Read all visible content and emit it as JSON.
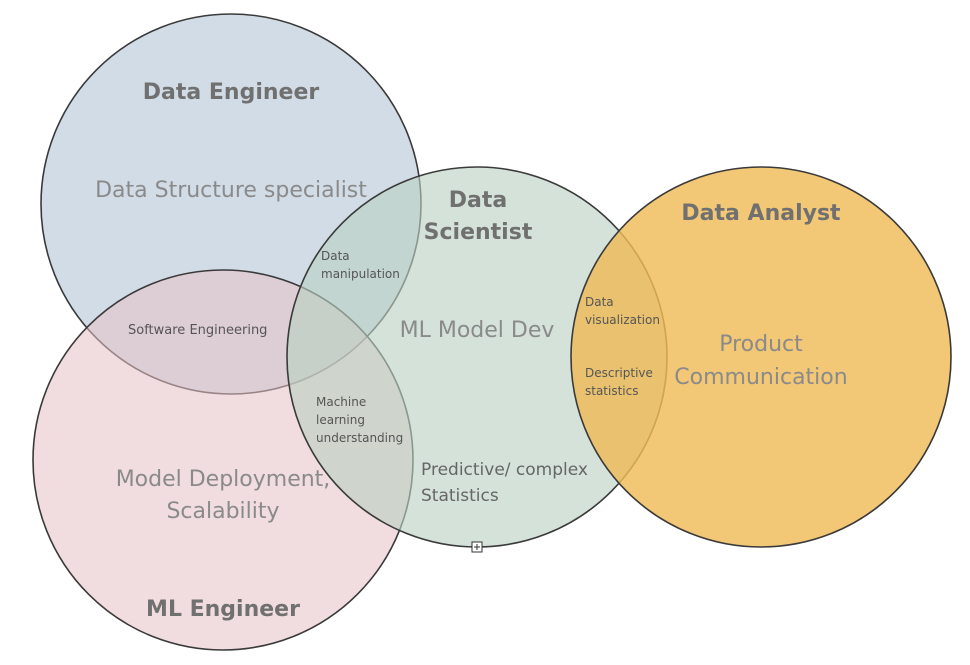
{
  "diagram": {
    "colors": {
      "data_engineer": "#a9bccf",
      "ml_engineer": "#e6c1c4",
      "data_scientist": "#b9d1c1",
      "data_analyst": "#efbb58",
      "outline": "#3a3a3a"
    },
    "roles": {
      "data_engineer": "Data Engineer",
      "data_scientist_line1": "Data",
      "data_scientist_line2": "Scientist",
      "data_analyst": "Data Analyst",
      "ml_engineer": "ML Engineer"
    },
    "skills": {
      "data_structure": "Data Structure specialist",
      "ml_model_dev": "ML Model Dev",
      "product_communication_line1": "Product",
      "product_communication_line2": "Communication",
      "model_deployment_line1": "Model Deployment,",
      "model_deployment_line2": "Scalability",
      "predictive_line1": "Predictive/ complex",
      "predictive_line2": "Statistics"
    },
    "overlaps": {
      "data_manipulation_line1": "Data",
      "data_manipulation_line2": "manipulation",
      "software_engineering": "Software Engineering",
      "machine_learning_line1": "Machine",
      "machine_learning_line2": "learning",
      "machine_learning_line3": "understanding",
      "data_visualization_line1": "Data",
      "data_visualization_line2": "visualization",
      "descriptive_statistics_line1": "Descriptive",
      "descriptive_statistics_line2": "statistics"
    }
  }
}
